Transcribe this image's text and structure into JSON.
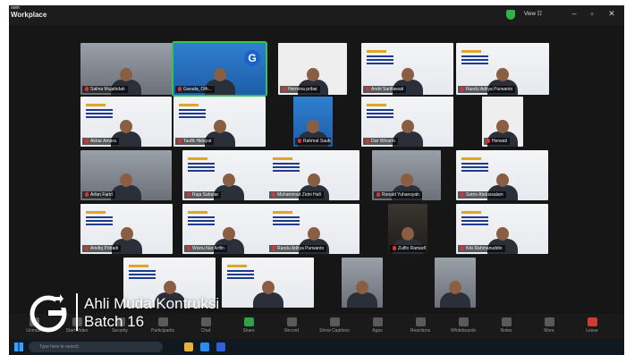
{
  "window": {
    "app_title_small": "oom",
    "app_title": "Workplace",
    "view_label": "View ☷"
  },
  "tiles": [
    {
      "name": "Salma Mujahidah",
      "theme": "room"
    },
    {
      "name": "Garuda_Oth...",
      "theme": "blue",
      "active": true
    },
    {
      "name": "Hermina pribai",
      "theme": "white"
    },
    {
      "name": "Andri Sarifiawati",
      "theme": "slide"
    },
    {
      "name": "Randu Aditya Purwanto",
      "theme": "slide"
    },
    {
      "name": "Akbar Amara",
      "theme": "slide"
    },
    {
      "name": "Taufik Hidayat",
      "theme": "slide"
    },
    {
      "name": "Rahmat Saufani",
      "theme": "blue"
    },
    {
      "name": "Dwi Winarto",
      "theme": "slide"
    },
    {
      "name": "Herwati",
      "theme": "white"
    },
    {
      "name": "Arfan Farid",
      "theme": "room"
    },
    {
      "name": "Raja Sahutar",
      "theme": "slide"
    },
    {
      "name": "Muhammad Zidni Hafi",
      "theme": "slide"
    },
    {
      "name": "Ronald Yuhansyah",
      "theme": "room"
    },
    {
      "name": "Satrio Abdussalam",
      "theme": "slide"
    },
    {
      "name": "Ariefiq Pribadi",
      "theme": "slide"
    },
    {
      "name": "Wisnu Nur Arifin",
      "theme": "slide"
    },
    {
      "name": "Randu Aditya Purwanto",
      "theme": "slide"
    },
    {
      "name": "Zulfio Ramadhan",
      "theme": "room-dark"
    },
    {
      "name": "Kiki Rahmanuddin",
      "theme": "slide"
    },
    {
      "name": "",
      "theme": "slide"
    },
    {
      "name": "",
      "theme": "slide"
    },
    {
      "name": "",
      "theme": "room"
    },
    {
      "name": "",
      "theme": "room"
    }
  ],
  "toolbar": {
    "buttons": [
      "Unmute",
      "Start Video",
      "Security",
      "Participants",
      "Chat",
      "Share",
      "Record",
      "Show Captions",
      "Apps",
      "Reactions",
      "Whiteboards",
      "Notes",
      "More",
      "Leave"
    ]
  },
  "taskbar": {
    "search_placeholder": "Type here to search"
  },
  "overlay": {
    "line1": "Ahli Muda Kontruksi",
    "line2": "Batch 16"
  },
  "colors": {
    "active_speaker": "#36c25a",
    "mic_muted": "#e0312e",
    "brand_blue": "#1b63c6"
  }
}
